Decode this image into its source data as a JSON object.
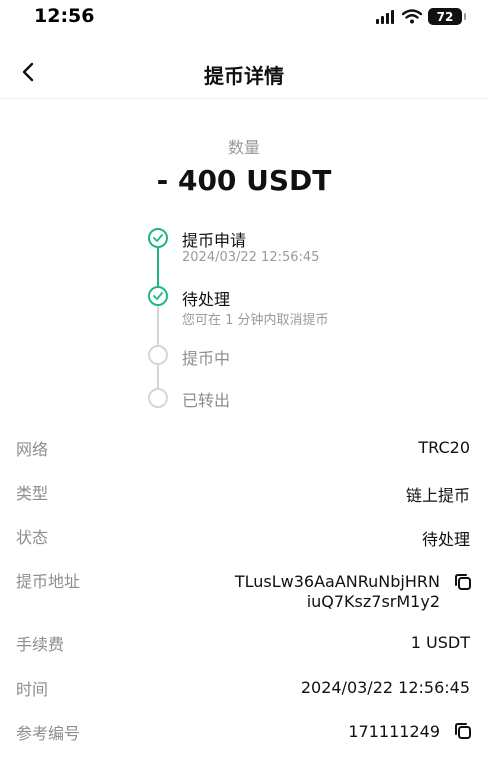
{
  "status_bar": {
    "time": "12:56",
    "battery": "72"
  },
  "header": {
    "title": "提币详情"
  },
  "amount": {
    "label": "数量",
    "value": "- 400 USDT"
  },
  "steps": [
    {
      "title": "提币申请",
      "subtitle": "2024/03/22 12:56:45",
      "done": true
    },
    {
      "title": "待处理",
      "subtitle": "您可在 1 分钟内取消提币",
      "done": true
    },
    {
      "title": "提币中",
      "done": false
    },
    {
      "title": "已转出",
      "done": false
    }
  ],
  "details": {
    "network": {
      "label": "网络",
      "value": "TRC20"
    },
    "type": {
      "label": "类型",
      "value": "链上提币"
    },
    "status": {
      "label": "状态",
      "value": "待处理"
    },
    "address": {
      "label": "提币地址",
      "line1": "TLusLw36AaANRuNbjHRN",
      "line2": "iuQ7Ksz7srM1y2"
    },
    "fee": {
      "label": "手续费",
      "value": "1 USDT"
    },
    "time": {
      "label": "时间",
      "value": "2024/03/22 12:56:45"
    },
    "reference": {
      "label": "参考编号",
      "value": "171111249"
    }
  },
  "colors": {
    "accent": "#20b686",
    "muted": "#9a9a9a",
    "inactive": "#d6d6d6"
  },
  "icons": [
    "back-arrow-icon",
    "check-icon",
    "copy-icon",
    "signal-icon",
    "wifi-icon",
    "battery-icon"
  ]
}
